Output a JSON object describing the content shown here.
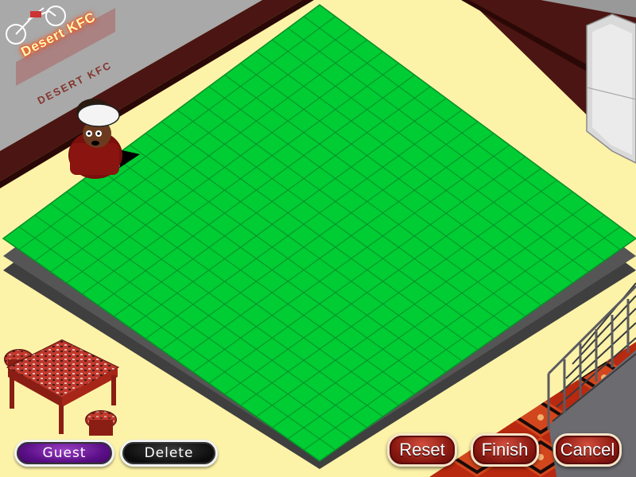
{
  "store": {
    "sign_text": "Desert KFC",
    "sign_reflection": "DESERT KFC"
  },
  "colors": {
    "floor": "#fdf3a8",
    "wall": "#4a1512",
    "grid_fill": "#00cc33",
    "grid_line": "#0a8f2a",
    "border_tiles": "#4a4a4a"
  },
  "grid": {
    "rows": 20,
    "cols": 20
  },
  "buttons": {
    "guest": "Guest",
    "delete": "Delete",
    "reset": "Reset",
    "finish": "Finish",
    "cancel": "Cancel"
  },
  "icons": {
    "rotate": "rotate-arrows-icon",
    "chef": "chef-character",
    "table": "dining-table",
    "stairs": "staircase",
    "display_case": "glass-display-case",
    "motorcycle": "motorcycle"
  }
}
